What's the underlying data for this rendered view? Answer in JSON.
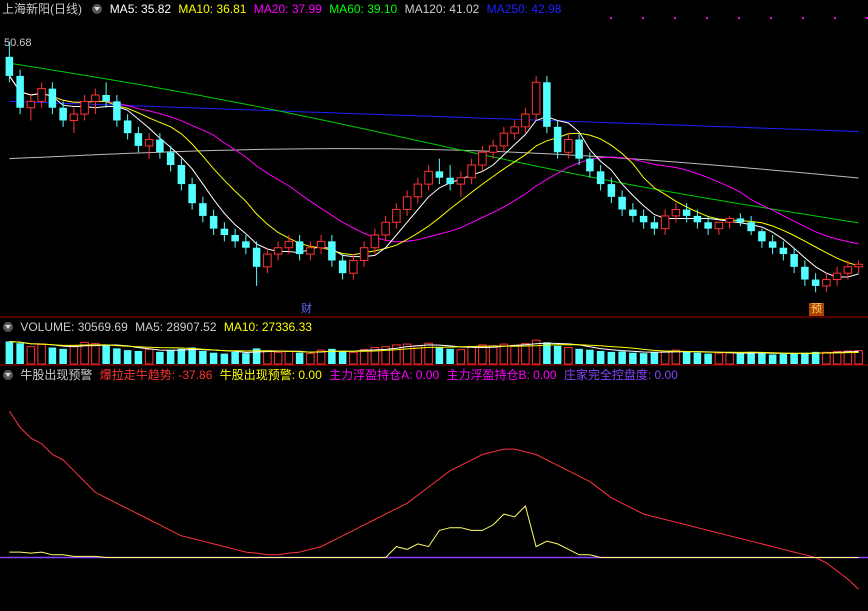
{
  "price_panel": {
    "title": "上海新阳(日线)",
    "ma_labels": [
      {
        "label": "MA5: 35.82",
        "color": "#ffffff"
      },
      {
        "label": "MA10: 36.81",
        "color": "#ffff00"
      },
      {
        "label": "MA20: 37.99",
        "color": "#ff00ff"
      },
      {
        "label": "MA60: 39.10",
        "color": "#00ff00"
      },
      {
        "label": "MA120: 41.02",
        "color": "#cccccc"
      },
      {
        "label": "MA250: 42.98",
        "color": "#2020ff"
      }
    ],
    "high_marker": "50.68",
    "event_tags": [
      {
        "text": "财",
        "color": "#6666ff"
      },
      {
        "text": "预",
        "color": "#ffcc66",
        "bg": "#aa4400"
      }
    ]
  },
  "volume_panel": {
    "labels": [
      {
        "label": "VOLUME: 30569.69",
        "color": "#cccccc"
      },
      {
        "label": "MA5: 28907.52",
        "color": "#cccccc"
      },
      {
        "label": "MA10: 27336.33",
        "color": "#ffff00"
      }
    ]
  },
  "indicator_panel": {
    "labels": [
      {
        "label": "牛股出现预警",
        "color": "#cccccc"
      },
      {
        "label": "爆拉走牛趋势: -37.86",
        "color": "#ff3333"
      },
      {
        "label": "牛股出现预警: 0.00",
        "color": "#ffff00"
      },
      {
        "label": "主力浮盈持仓A: 0.00",
        "color": "#ff00ff"
      },
      {
        "label": "主力浮盈持仓B: 0.00",
        "color": "#ff00ff"
      },
      {
        "label": "庄家完全控盘度: 0.00",
        "color": "#8844ff"
      }
    ]
  },
  "colors": {
    "up": "#ff3333",
    "down": "#54ffff",
    "grid": "#aa0000",
    "background": "#000000"
  },
  "chart_data": [
    {
      "type": "candlestick",
      "series": [
        {
          "name": "MA5",
          "values": [
            49.5,
            49.0,
            48.5,
            48.0,
            47.5,
            47.0,
            46.5,
            46.0,
            46.0,
            46.0,
            45.8,
            45.5,
            45.0,
            44.5,
            44.0,
            43.5,
            43.0,
            42.5,
            42.0,
            41.5,
            41.0,
            40.5,
            40.0,
            39.5,
            39.0,
            38.5,
            38.0,
            37.5,
            37.5,
            37.5,
            37.5,
            37.5,
            37.5,
            37.5,
            38.0,
            38.5,
            39.0,
            39.5,
            40.0,
            40.5,
            41.0,
            41.5,
            42.0,
            42.5,
            43.0,
            43.5,
            44.0,
            44.5,
            45.0,
            45.5,
            46.0,
            46.0,
            46.0,
            45.5,
            45.0,
            44.5,
            44.0,
            43.5,
            43.0,
            42.5,
            42.0,
            41.5,
            41.0,
            41.0,
            41.0,
            40.8,
            40.5,
            40.2,
            40.0,
            39.8,
            39.5,
            39.0,
            38.5,
            38.0,
            37.5,
            37.0,
            36.5,
            36.0,
            35.8,
            35.8
          ]
        }
      ],
      "ohlc": [
        [
          49.5,
          50.68,
          47.5,
          48.0
        ],
        [
          48.0,
          48.5,
          45.0,
          45.5
        ],
        [
          45.5,
          46.5,
          44.5,
          46.0
        ],
        [
          46.0,
          47.5,
          45.5,
          47.0
        ],
        [
          47.0,
          47.5,
          45.0,
          45.5
        ],
        [
          45.5,
          46.0,
          44.0,
          44.5
        ],
        [
          44.5,
          45.5,
          43.5,
          45.0
        ],
        [
          45.0,
          46.5,
          44.5,
          46.0
        ],
        [
          46.0,
          47.0,
          45.0,
          46.5
        ],
        [
          46.5,
          47.5,
          45.5,
          46.0
        ],
        [
          46.0,
          46.5,
          44.0,
          44.5
        ],
        [
          44.5,
          45.0,
          43.0,
          43.5
        ],
        [
          43.5,
          44.0,
          42.0,
          42.5
        ],
        [
          42.5,
          43.5,
          41.5,
          43.0
        ],
        [
          43.0,
          43.5,
          41.5,
          42.0
        ],
        [
          42.0,
          42.5,
          40.5,
          41.0
        ],
        [
          41.0,
          41.5,
          39.0,
          39.5
        ],
        [
          39.5,
          40.0,
          37.5,
          38.0
        ],
        [
          38.0,
          38.5,
          36.5,
          37.0
        ],
        [
          37.0,
          37.5,
          35.5,
          36.0
        ],
        [
          36.0,
          36.5,
          35.0,
          35.5
        ],
        [
          35.5,
          36.0,
          34.5,
          35.0
        ],
        [
          35.0,
          35.5,
          34.0,
          34.5
        ],
        [
          34.5,
          35.0,
          31.5,
          33.0
        ],
        [
          33.0,
          34.5,
          32.5,
          34.0
        ],
        [
          34.0,
          35.0,
          33.5,
          34.5
        ],
        [
          34.5,
          35.5,
          34.0,
          35.0
        ],
        [
          35.0,
          35.5,
          33.5,
          34.0
        ],
        [
          34.0,
          35.0,
          33.5,
          34.5
        ],
        [
          34.5,
          35.5,
          34.0,
          35.0
        ],
        [
          35.0,
          35.5,
          33.0,
          33.5
        ],
        [
          33.5,
          34.0,
          32.0,
          32.5
        ],
        [
          32.5,
          34.0,
          32.0,
          33.5
        ],
        [
          33.5,
          35.0,
          33.0,
          34.5
        ],
        [
          34.5,
          36.0,
          34.0,
          35.5
        ],
        [
          35.5,
          37.0,
          35.0,
          36.5
        ],
        [
          36.5,
          38.0,
          36.0,
          37.5
        ],
        [
          37.5,
          39.0,
          37.0,
          38.5
        ],
        [
          38.5,
          40.0,
          38.0,
          39.5
        ],
        [
          39.5,
          41.0,
          39.0,
          40.5
        ],
        [
          40.5,
          41.5,
          39.5,
          40.0
        ],
        [
          40.0,
          41.0,
          39.0,
          39.5
        ],
        [
          39.5,
          40.5,
          38.5,
          40.0
        ],
        [
          40.0,
          41.5,
          39.5,
          41.0
        ],
        [
          41.0,
          42.5,
          40.5,
          42.0
        ],
        [
          42.0,
          43.0,
          41.5,
          42.5
        ],
        [
          42.5,
          44.0,
          42.0,
          43.5
        ],
        [
          43.5,
          44.5,
          43.0,
          44.0
        ],
        [
          44.0,
          45.5,
          43.5,
          45.0
        ],
        [
          45.0,
          48.0,
          44.5,
          47.5
        ],
        [
          47.5,
          48.0,
          43.5,
          44.0
        ],
        [
          44.0,
          44.5,
          41.5,
          42.0
        ],
        [
          42.0,
          43.5,
          41.5,
          43.0
        ],
        [
          43.0,
          43.5,
          41.0,
          41.5
        ],
        [
          41.5,
          42.0,
          40.0,
          40.5
        ],
        [
          40.5,
          41.0,
          39.0,
          39.5
        ],
        [
          39.5,
          40.0,
          38.0,
          38.5
        ],
        [
          38.5,
          39.0,
          37.0,
          37.5
        ],
        [
          37.5,
          38.0,
          36.5,
          37.0
        ],
        [
          37.0,
          37.5,
          36.0,
          36.5
        ],
        [
          36.5,
          37.0,
          35.5,
          36.0
        ],
        [
          36.0,
          37.5,
          35.5,
          37.0
        ],
        [
          37.0,
          38.0,
          36.5,
          37.5
        ],
        [
          37.5,
          38.0,
          36.5,
          37.0
        ],
        [
          37.0,
          37.5,
          36.0,
          36.5
        ],
        [
          36.5,
          37.0,
          35.5,
          36.0
        ],
        [
          36.0,
          36.5,
          35.5,
          36.5
        ],
        [
          36.5,
          37.0,
          36.0,
          36.8
        ],
        [
          36.8,
          37.2,
          36.2,
          36.5
        ],
        [
          36.5,
          37.0,
          35.5,
          35.8
        ],
        [
          35.8,
          36.0,
          34.5,
          35.0
        ],
        [
          35.0,
          35.5,
          34.0,
          34.5
        ],
        [
          34.5,
          35.0,
          33.5,
          34.0
        ],
        [
          34.0,
          34.5,
          32.5,
          33.0
        ],
        [
          33.0,
          33.5,
          31.5,
          32.0
        ],
        [
          32.0,
          32.5,
          31.0,
          31.5
        ],
        [
          31.5,
          32.5,
          31.0,
          32.0
        ],
        [
          32.0,
          33.0,
          31.5,
          32.5
        ],
        [
          32.5,
          33.5,
          32.0,
          33.0
        ],
        [
          33.0,
          33.5,
          32.5,
          33.2
        ]
      ],
      "ylim": [
        30,
        52
      ]
    },
    {
      "type": "bar",
      "series": [
        {
          "name": "VOLUME",
          "values": [
            52,
            48,
            40,
            45,
            38,
            35,
            42,
            50,
            47,
            44,
            36,
            32,
            30,
            34,
            28,
            33,
            35,
            38,
            30,
            26,
            24,
            28,
            25,
            36,
            30,
            27,
            29,
            26,
            24,
            32,
            35,
            30,
            27,
            33,
            38,
            40,
            44,
            46,
            42,
            48,
            38,
            35,
            33,
            40,
            44,
            42,
            46,
            43,
            47,
            55,
            50,
            42,
            38,
            35,
            33,
            30,
            28,
            29,
            26,
            25,
            27,
            30,
            32,
            28,
            26,
            24,
            25,
            26,
            24,
            28,
            25,
            22,
            23,
            24,
            26,
            28,
            27,
            29,
            30,
            31
          ]
        }
      ],
      "ylim": [
        0,
        60
      ]
    },
    {
      "type": "line",
      "series": [
        {
          "name": "爆拉走牛趋势",
          "values": [
            -5,
            -8,
            -10,
            -11,
            -13,
            -14,
            -16,
            -18,
            -20,
            -21,
            -22,
            -23,
            -24,
            -25,
            -26,
            -27,
            -28,
            -28.5,
            -29,
            -29.5,
            -30,
            -30.5,
            -31,
            -31.2,
            -31.5,
            -31.5,
            -31.2,
            -31,
            -30.5,
            -30,
            -29,
            -28,
            -27,
            -26,
            -25,
            -24,
            -23,
            -22,
            -20.5,
            -19,
            -17.5,
            -16,
            -15,
            -14,
            -13,
            -12.5,
            -12,
            -12,
            -12.5,
            -13,
            -14,
            -15,
            -16,
            -17,
            -18,
            -19.5,
            -21,
            -22,
            -23,
            -24,
            -24.5,
            -25,
            -25.5,
            -26,
            -26.5,
            -27,
            -27.5,
            -28,
            -28.5,
            -29,
            -29.5,
            -30,
            -30.5,
            -31,
            -31.5,
            -32,
            -33,
            -34.5,
            -36,
            -37.86
          ]
        },
        {
          "name": "牛股出现预警",
          "values": [
            -31,
            -31,
            -31.2,
            -31,
            -31.5,
            -31.5,
            -31.8,
            -31.8,
            -31.8,
            -32,
            -32,
            -32,
            -32,
            -32,
            -32,
            -32,
            -32,
            -32,
            -32,
            -32,
            -32,
            -32,
            -32,
            -32,
            -32,
            -32,
            -32,
            -32,
            -32,
            -32,
            -32,
            -32,
            -32,
            -32,
            -32,
            -32,
            -30,
            -30.5,
            -29.5,
            -30,
            -27,
            -26.5,
            -26.5,
            -27,
            -27,
            -26,
            -24,
            -24.5,
            -22.5,
            -30,
            -29,
            -29.5,
            -30.5,
            -31.5,
            -31.5,
            -32,
            -32,
            -32,
            -32,
            -32,
            -32,
            -32,
            -32,
            -32,
            -32,
            -32,
            -32,
            -32,
            -32,
            -32,
            -32,
            -32,
            -32,
            -32,
            -32,
            -32,
            -32,
            -32,
            -32,
            -32
          ]
        }
      ],
      "ylim": [
        -38,
        0
      ]
    }
  ]
}
